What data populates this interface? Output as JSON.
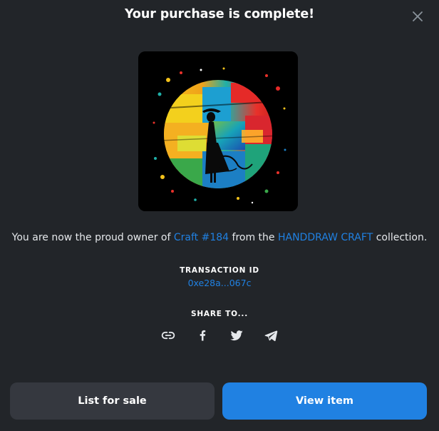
{
  "dialog": {
    "title": "Your purchase is complete!",
    "close_icon": "close-icon"
  },
  "nft": {
    "image_description_icon": "nft-artwork"
  },
  "owner_message": {
    "prefix": "You are now the proud owner of ",
    "item_name": "Craft #184",
    "middle": " from the ",
    "collection_name": "HANDDRAW CRAFT",
    "suffix": " collection."
  },
  "transaction": {
    "label": "TRANSACTION ID",
    "id": "0xe28a...067c"
  },
  "share": {
    "label": "SHARE TO...",
    "icons": [
      "link-icon",
      "facebook-icon",
      "twitter-icon",
      "telegram-icon"
    ]
  },
  "actions": {
    "list_for_sale": "List for sale",
    "view_item": "View item"
  },
  "colors": {
    "accent": "#2081e2",
    "background": "#222529",
    "secondary_button": "#35383f"
  }
}
